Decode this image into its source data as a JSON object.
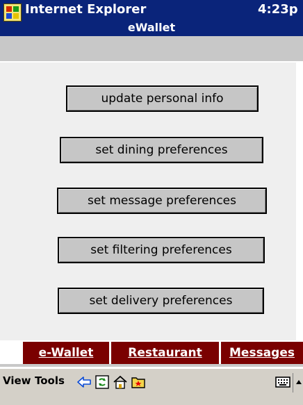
{
  "titlebar": {
    "app_title": "Internet Explorer",
    "clock": "4:23p",
    "page_title": "eWallet"
  },
  "buttons": [
    {
      "label": "update personal info"
    },
    {
      "label": "set dining preferences"
    },
    {
      "label": "set message preferences"
    },
    {
      "label": "set filtering preferences"
    },
    {
      "label": "set delivery preferences"
    }
  ],
  "nav": {
    "tabs": [
      {
        "label": "e-Wallet"
      },
      {
        "label": "Restaurant"
      },
      {
        "label": "Messages"
      }
    ]
  },
  "cmdbar": {
    "menus": [
      {
        "label": "View"
      },
      {
        "label": "Tools"
      }
    ],
    "icons": [
      "back-arrow-icon",
      "refresh-icon",
      "home-icon",
      "favorites-icon",
      "keyboard-icon",
      "sip-arrow-icon"
    ]
  },
  "colors": {
    "titlebar": "#0a247a",
    "nav_tab": "#7a0000",
    "button_face": "#c6c6c6",
    "content_bg": "#efefef",
    "cmdbar": "#d4d0c8"
  }
}
